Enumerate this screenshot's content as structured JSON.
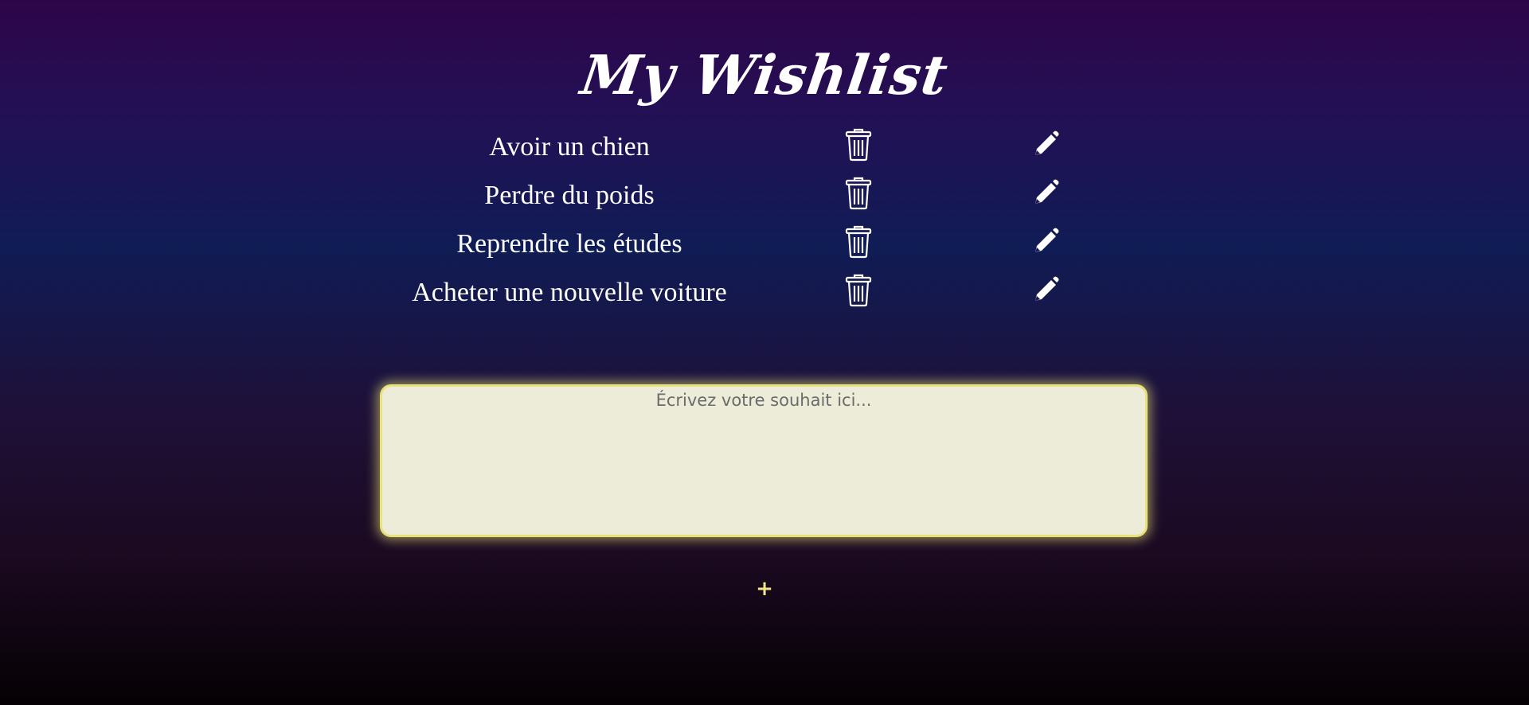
{
  "header": {
    "title": "My Wishlist"
  },
  "wishes": [
    {
      "text": "Avoir un chien"
    },
    {
      "text": "Perdre du poids"
    },
    {
      "text": "Reprendre les études"
    },
    {
      "text": "Acheter une nouvelle voiture"
    }
  ],
  "icons": {
    "delete": "trash-icon",
    "edit": "pencil-icon"
  },
  "input": {
    "value": "",
    "placeholder": "Écrivez votre souhait ici..."
  },
  "add_button": {
    "label": "+"
  },
  "colors": {
    "text": "#ffffff",
    "input_background": "#ececd8",
    "input_glow": "#e8e27a",
    "add_button": "#f0e58a"
  }
}
